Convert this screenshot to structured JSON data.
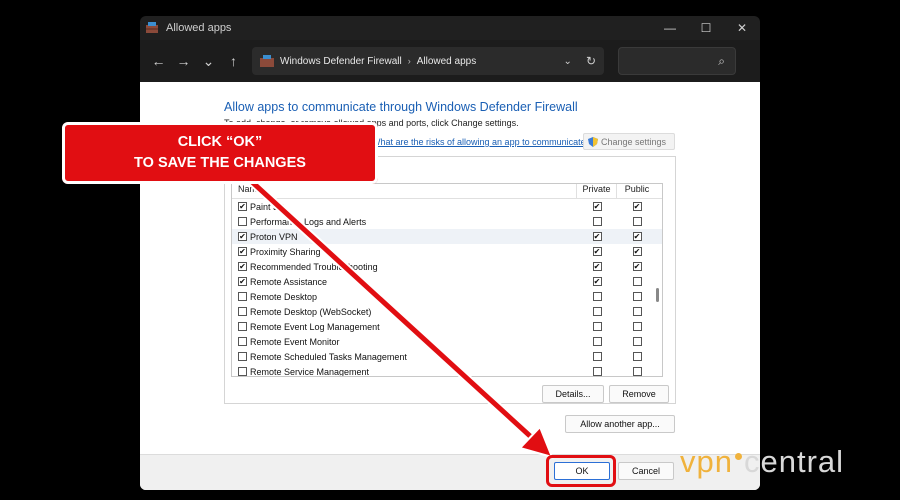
{
  "window": {
    "title": "Allowed apps",
    "controls": {
      "minimize": "—",
      "maximize": "☐",
      "close": "✕"
    }
  },
  "toolbar": {
    "back": "←",
    "forward": "→",
    "recent": "⌄",
    "up": "↑",
    "breadcrumb": [
      "Windows Defender Firewall",
      "Allowed apps"
    ],
    "breadcrumb_sep": "›",
    "dropdown": "⌄",
    "refresh": "↻",
    "search_icon": "⌕"
  },
  "content": {
    "heading": "Allow apps to communicate through Windows Defender Firewall",
    "subtext": "To add, change, or remove allowed apps and ports, click Change settings.",
    "risk_link": "What are the risks of allowing an app to communicate?",
    "change_settings_label": "Change settings",
    "columns": {
      "name": "Name",
      "private": "Private",
      "public": "Public"
    },
    "apps": [
      {
        "name": "Paint 3D",
        "enabled": true,
        "private": true,
        "public": true
      },
      {
        "name": "Performance Logs and Alerts",
        "enabled": false,
        "private": false,
        "public": false
      },
      {
        "name": "Proton VPN",
        "enabled": true,
        "private": true,
        "public": true
      },
      {
        "name": "Proximity Sharing",
        "enabled": true,
        "private": true,
        "public": true
      },
      {
        "name": "Recommended Troubleshooting",
        "enabled": true,
        "private": true,
        "public": true
      },
      {
        "name": "Remote Assistance",
        "enabled": true,
        "private": true,
        "public": false
      },
      {
        "name": "Remote Desktop",
        "enabled": false,
        "private": false,
        "public": false
      },
      {
        "name": "Remote Desktop (WebSocket)",
        "enabled": false,
        "private": false,
        "public": false
      },
      {
        "name": "Remote Event Log Management",
        "enabled": false,
        "private": false,
        "public": false
      },
      {
        "name": "Remote Event Monitor",
        "enabled": false,
        "private": false,
        "public": false
      },
      {
        "name": "Remote Scheduled Tasks Management",
        "enabled": false,
        "private": false,
        "public": false
      },
      {
        "name": "Remote Service Management",
        "enabled": false,
        "private": false,
        "public": false
      }
    ],
    "details_label": "Details...",
    "remove_label": "Remove",
    "allow_another_label": "Allow another app...",
    "ok_label": "OK",
    "cancel_label": "Cancel"
  },
  "annotation": {
    "line1": "CLICK “OK”",
    "line2": "TO SAVE THE CHANGES",
    "color": "#e10e12"
  },
  "watermark": {
    "part1": "vpn",
    "part2": "central"
  }
}
